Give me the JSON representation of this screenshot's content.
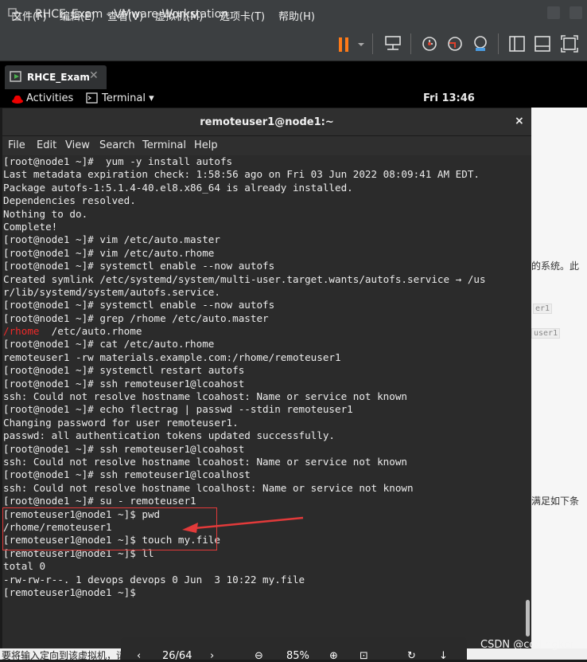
{
  "vmware": {
    "title": "RHCE_Exam - VMware Workstation",
    "menu": [
      "文件(F)",
      "编辑(E)",
      "查看(V)",
      "虚拟机(M)",
      "选项卡(T)",
      "帮助(H)"
    ],
    "tab_label": "RHCE_Exam",
    "tab_close": "✕"
  },
  "gnome": {
    "activities": "Activities",
    "terminal_menu": "Terminal ▾",
    "clock": "Fri 13:46"
  },
  "terminal": {
    "title": "remoteuser1@node1:~",
    "close": "×",
    "menu": [
      "File",
      "Edit",
      "View",
      "Search",
      "Terminal",
      "Help"
    ],
    "lines": [
      "[root@node1 ~]#  yum -y install autofs",
      "Last metadata expiration check: 1:58:56 ago on Fri 03 Jun 2022 08:09:41 AM EDT.",
      "Package autofs-1:5.1.4-40.el8.x86_64 is already installed.",
      "Dependencies resolved.",
      "Nothing to do.",
      "Complete!",
      "[root@node1 ~]# vim /etc/auto.master",
      "[root@node1 ~]# vim /etc/auto.rhome",
      "[root@node1 ~]# systemctl enable --now autofs",
      "Created symlink /etc/systemd/system/multi-user.target.wants/autofs.service → /us",
      "r/lib/systemd/system/autofs.service.",
      "[root@node1 ~]# systemctl enable --now autofs",
      "[root@node1 ~]# grep /rhome /etc/auto.master",
      "",
      "[root@node1 ~]# cat /etc/auto.rhome",
      "remoteuser1 -rw materials.example.com:/rhome/remoteuser1",
      "[root@node1 ~]# systemctl restart autofs",
      "[root@node1 ~]# ssh remoteuser1@lcoahost",
      "ssh: Could not resolve hostname lcoahost: Name or service not known",
      "[root@node1 ~]# echo flectrag | passwd --stdin remoteuser1",
      "Changing password for user remoteuser1.",
      "passwd: all authentication tokens updated successfully.",
      "[root@node1 ~]# ssh remoteuser1@lcoahost",
      "ssh: Could not resolve hostname lcoahost: Name or service not known",
      "[root@node1 ~]# ssh remoteuser1@lcoalhost",
      "ssh: Could not resolve hostname lcoalhost: Name or service not known",
      "[root@node1 ~]# su - remoteuser1",
      "[remoteuser1@node1 ~]$ pwd",
      "/rhome/remoteuser1",
      "[remoteuser1@node1 ~]$ touch my.file",
      "[remoteuser1@node1 ~]$ ll",
      "total 0",
      "-rw-rw-r--. 1 devops devops 0 Jun  3 10:22 my.file",
      "[remoteuser1@node1 ~]$"
    ],
    "grep_match": "/rhome",
    "grep_rest": "  /etc/auto.rhome"
  },
  "background_page": {
    "snippet1": "的系统。此",
    "badge1": "er1",
    "badge2": "user1",
    "snippet2": "满足如下条"
  },
  "status_bar": {
    "text": "要将输入定向到该虚拟机，请在虚拟机内部单击或按 Ctrl+G。"
  },
  "reader": {
    "page": "26/64",
    "zoom": "85%"
  },
  "watermark": "CSDN @codingker",
  "colors": {
    "highlight": "#e23a3a",
    "pause_icon": "#ff7a18",
    "terminal_bg": "#2b2b2b"
  }
}
